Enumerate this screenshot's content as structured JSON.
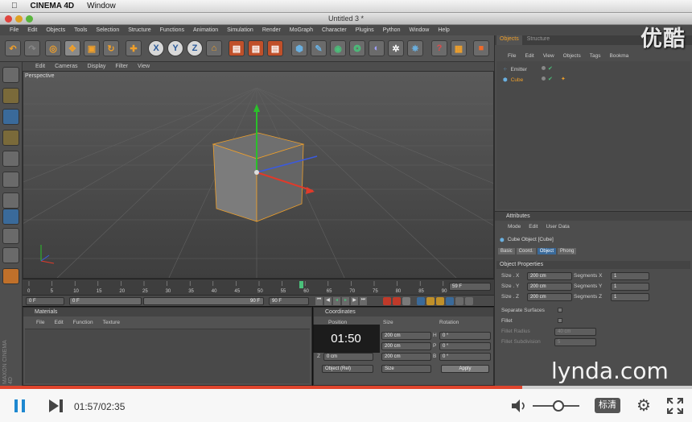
{
  "mac_menu": {
    "app": "CINEMA 4D",
    "window": "Window"
  },
  "window_title": "Untitled 3 *",
  "c4d_menu": [
    "File",
    "Edit",
    "Objects",
    "Tools",
    "Selection",
    "Structure",
    "Functions",
    "Animation",
    "Simulation",
    "Render",
    "MoGraph",
    "Character",
    "Plugins",
    "Python",
    "Window",
    "Help"
  ],
  "toolbar_letters": [
    "X",
    "Y",
    "Z"
  ],
  "viewport": {
    "menu": [
      "Edit",
      "Cameras",
      "Display",
      "Filter",
      "View"
    ],
    "label": "Perspective"
  },
  "timeline": {
    "ticks": [
      "0",
      "5",
      "10",
      "15",
      "20",
      "25",
      "30",
      "35",
      "40",
      "45",
      "50",
      "55",
      "60",
      "65",
      "70",
      "75",
      "80",
      "85",
      "90"
    ],
    "current": "0 F",
    "min": "0 F",
    "max": "90 F",
    "end": "90 F",
    "frame_field": "59 F"
  },
  "materials": {
    "title": "Materials",
    "menu": [
      "File",
      "Edit",
      "Function",
      "Texture"
    ]
  },
  "coords": {
    "title": "Coordinates",
    "headers": [
      "Position",
      "Size",
      "Rotation"
    ],
    "rows": [
      {
        "axis": "X",
        "pos": "0 cm",
        "size": "200 cm",
        "rlabel": "H",
        "rot": "0 °"
      },
      {
        "axis": "Y",
        "pos": "0 cm",
        "size": "200 cm",
        "rlabel": "P",
        "rot": "0 °"
      },
      {
        "axis": "Z",
        "pos": "0 cm",
        "size": "200 cm",
        "rlabel": "B",
        "rot": "0 °"
      }
    ],
    "mode": "Object (Rel)",
    "sizemode": "Size",
    "apply": "Apply"
  },
  "objmanager": {
    "tabs": [
      "Objects",
      "Structure"
    ],
    "menu": [
      "File",
      "Edit",
      "View",
      "Objects",
      "Tags",
      "Bookma"
    ],
    "items": [
      "Emitter",
      "Cube"
    ]
  },
  "attributes": {
    "title": "Attributes",
    "menu": [
      "Mode",
      "Edit",
      "User Data"
    ],
    "object_name": "Cube Object [Cube]",
    "tabs": [
      "Basic",
      "Coord.",
      "Object",
      "Phong"
    ],
    "section": "Object Properties",
    "sizes": [
      {
        "label": "Size . X",
        "value": "200 cm",
        "seg": "Segments X",
        "segval": "1"
      },
      {
        "label": "Size . Y",
        "value": "200 cm",
        "seg": "Segments Y",
        "segval": "1"
      },
      {
        "label": "Size . Z",
        "value": "200 cm",
        "seg": "Segments Z",
        "segval": "1"
      }
    ],
    "separate": "Separate Surfaces",
    "fillet": "Fillet",
    "fillet_radius": "Fillet Radius",
    "fillet_radius_val": "40 cm",
    "fillet_sub": "Fillet Subdivision",
    "fillet_sub_val": "5"
  },
  "watermarks": {
    "youku": "优酷",
    "lynda": "lynda.com"
  },
  "overlay_time": "01:50",
  "player": {
    "time": "01:57/02:35",
    "quality": "标清",
    "progress_fraction": 0.755,
    "volume_fraction": 0.55
  },
  "colors": {
    "accent": "#e0452d",
    "c4d_orange": "#f0a02a",
    "ui_dark": "#4d4d4d"
  }
}
